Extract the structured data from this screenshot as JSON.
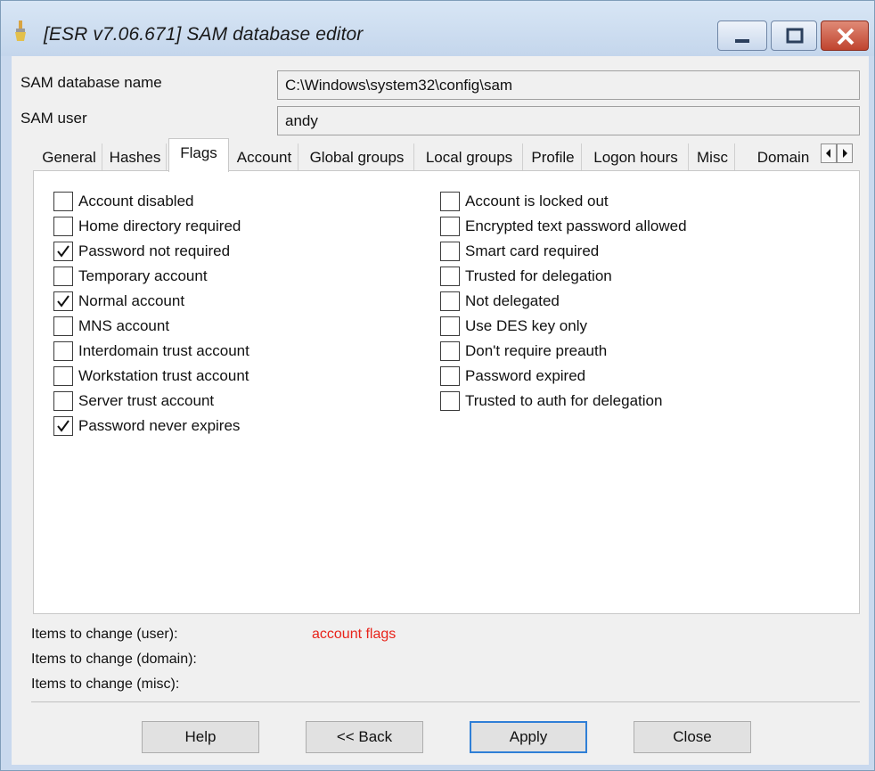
{
  "window": {
    "title": "[ESR v7.06.671]  SAM database editor"
  },
  "fields": {
    "db_name_label": "SAM database name",
    "db_name_value": "C:\\Windows\\system32\\config\\sam",
    "user_label": "SAM user",
    "user_value": "andy"
  },
  "tabs": [
    "General",
    "Hashes",
    "Flags",
    "Account",
    "Global groups",
    "Local groups",
    "Profile",
    "Logon hours",
    "Misc",
    "Domain"
  ],
  "active_tab": "Flags",
  "flags_left": [
    {
      "label": "Account disabled",
      "checked": false
    },
    {
      "label": "Home directory required",
      "checked": false
    },
    {
      "label": "Password not required",
      "checked": true
    },
    {
      "label": "Temporary account",
      "checked": false
    },
    {
      "label": "Normal account",
      "checked": true
    },
    {
      "label": "MNS account",
      "checked": false
    },
    {
      "label": "Interdomain trust account",
      "checked": false
    },
    {
      "label": "Workstation trust account",
      "checked": false
    },
    {
      "label": "Server trust account",
      "checked": false
    },
    {
      "label": "Password never expires",
      "checked": true
    }
  ],
  "flags_right": [
    {
      "label": "Account is locked out",
      "checked": false
    },
    {
      "label": "Encrypted text password allowed",
      "checked": false
    },
    {
      "label": "Smart card required",
      "checked": false
    },
    {
      "label": "Trusted for delegation",
      "checked": false
    },
    {
      "label": "Not delegated",
      "checked": false
    },
    {
      "label": "Use DES key only",
      "checked": false
    },
    {
      "label": "Don't require preauth",
      "checked": false
    },
    {
      "label": "Password expired",
      "checked": false
    },
    {
      "label": "Trusted to auth for delegation",
      "checked": false
    }
  ],
  "changes": {
    "user_label": "Items to change (user):",
    "user_value": "account flags",
    "domain_label": "Items to change (domain):",
    "misc_label": "Items to change (misc):",
    "value_color": "#e8231a"
  },
  "buttons": {
    "help": "Help",
    "back": "<< Back",
    "apply": "Apply",
    "close": "Close"
  },
  "icons": {
    "app": "paint-brush-icon",
    "minimize": "minimize-icon",
    "maximize": "maximize-icon",
    "close": "close-icon",
    "tab_scroll_left": "chevron-left-icon",
    "tab_scroll_right": "chevron-right-icon",
    "check": "checkmark-icon"
  }
}
